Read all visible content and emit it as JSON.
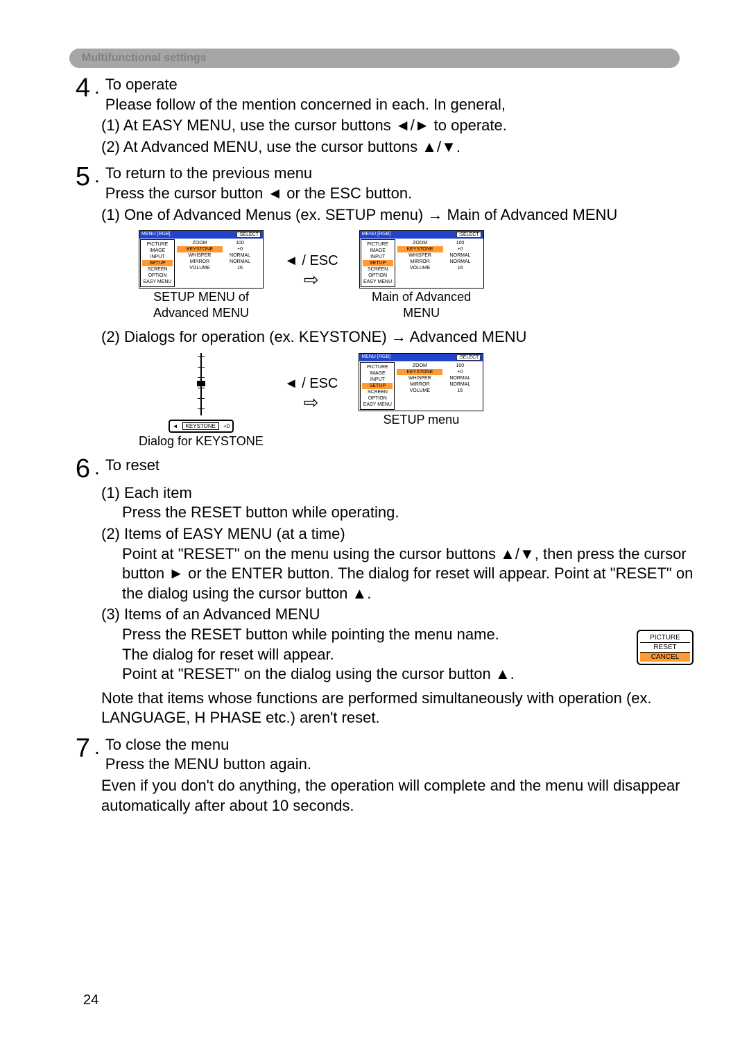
{
  "section_title": "Multifunctional settings",
  "step4": {
    "num": "4",
    "title": "To operate",
    "line1": "Please follow of the mention concerned in each. In general,",
    "line2": "(1) At EASY MENU, use the cursor buttons ◄/► to operate.",
    "line3": "(2) At Advanced MENU, use the cursor buttons ▲/▼."
  },
  "step5": {
    "num": "5",
    "title": "To return to the previous menu",
    "line1": "Press the cursor button ◄ or the ESC button.",
    "line2": "(1) One of Advanced Menus (ex. SETUP menu) → Main of Advanced MENU",
    "line3": "(2) Dialogs for operation (ex. KEYSTONE) → Advanced MENU"
  },
  "menu": {
    "title": "MENU [RGB]",
    "select": ":SELECT",
    "left": [
      "PICTURE",
      "IMAGE",
      "INPUT",
      "SETUP",
      "SCREEN",
      "OPTION",
      "EASY MENU"
    ],
    "mid": [
      "ZOOM",
      "KEYSTONE",
      "WHISPER",
      "MIRROR",
      "VOLUME"
    ],
    "right": [
      "100",
      "+0",
      "NORMAL",
      "NORMAL",
      "16"
    ]
  },
  "arrow_label": "◄ / ESC",
  "big_arrow": "⇨",
  "diagram1": {
    "left_caption_1": "SETUP MENU of",
    "left_caption_2": "Advanced MENU",
    "right_caption_1": "Main of Advanced",
    "right_caption_2": "MENU"
  },
  "diagram2": {
    "left_caption": "Dialog for KEYSTONE",
    "right_caption": "SETUP menu",
    "keystone_label": "KEYSTONE",
    "keystone_val": "+0"
  },
  "step6": {
    "num": "6",
    "title": "To reset",
    "item1_h": "(1) Each item",
    "item1_b": "Press the RESET button while operating.",
    "item2_h": "(2) Items of EASY MENU (at a time)",
    "item2_b": "Point at \"RESET\" on the menu using the cursor buttons ▲/▼, then press the cursor button ► or the ENTER button. The dialog for reset will appear. Point at \"RESET\" on the dialog using the cursor button ▲.",
    "item3_h": "(3) Items of an Advanced MENU",
    "item3_b1": "Press the RESET button while pointing the menu name.",
    "item3_b2": "The dialog for reset will appear.",
    "item3_b3": "Point at \"RESET\" on the dialog using the cursor button ▲.",
    "note": "Note that items whose functions are performed simultaneously with operation (ex. LANGUAGE, H PHASE etc.) aren't reset."
  },
  "reset_dialog": {
    "l1": "PICTURE",
    "l2": "RESET",
    "l3": "CANCEL"
  },
  "step7": {
    "num": "7",
    "title": "To close the menu",
    "line1": "Press the MENU button again.",
    "line2": "Even if you don't do anything, the operation will complete and the menu will disappear automatically after about 10 seconds."
  },
  "page_number": "24"
}
